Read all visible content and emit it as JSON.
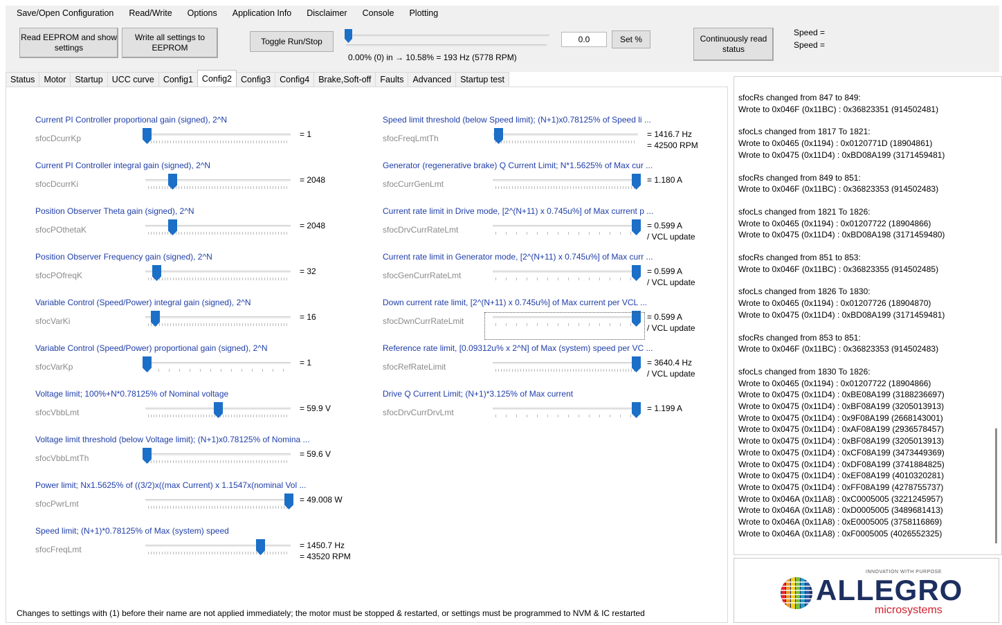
{
  "menu": [
    "Save/Open Configuration",
    "Read/Write",
    "Options",
    "Application Info",
    "Disclaimer",
    "Console",
    "Plotting"
  ],
  "toolbar": {
    "read_eeprom": "Read EEPROM and show settings",
    "write_all": "Write all settings to EEPROM",
    "toggle_run": "Toggle Run/Stop",
    "range_text": "0.00% (0) in → 10.58% = 193 Hz (5778 RPM)",
    "pct_value": "0.0",
    "set_pct": "Set %",
    "continuous": "Continuously read status",
    "speed1": "Speed =",
    "speed2": "Speed ="
  },
  "tabs": [
    "Status",
    "Motor",
    "Startup",
    "UCC curve",
    "Config1",
    "Config2",
    "Config3",
    "Config4",
    "Brake,Soft-off",
    "Faults",
    "Advanced",
    "Startup test"
  ],
  "active_tab": "Config2",
  "left_params": [
    {
      "title": "Current PI Controller proportional gain (signed), 2^N",
      "name": "sfocDcurrKp",
      "value": "= 1",
      "value2": "",
      "level": 0.0
    },
    {
      "title": "Current PI Controller integral gain (signed), 2^N",
      "name": "sfocDcurrKi",
      "value": "= 2048",
      "value2": "",
      "level": 0.18
    },
    {
      "title": "Position Observer Theta gain (signed), 2^N",
      "name": "sfocPOthetaK",
      "value": "= 2048",
      "value2": "",
      "level": 0.18
    },
    {
      "title": "Position Observer Frequency gain (signed), 2^N",
      "name": "sfocPOfreqK",
      "value": "= 32",
      "value2": "",
      "level": 0.07
    },
    {
      "title": "Variable Control (Speed/Power) integral gain (signed), 2^N",
      "name": "sfocVarKi",
      "value": "= 16",
      "value2": "",
      "level": 0.06
    },
    {
      "title": "Variable Control (Speed/Power) proportional gain (signed), 2^N",
      "name": "sfocVarKp",
      "value": "= 1",
      "value2": "",
      "level": 0.0
    },
    {
      "title": "Voltage limit; 100%+N*0.78125% of Nominal voltage",
      "name": "sfocVbbLmt",
      "value": "= 59.9 V",
      "value2": "",
      "level": 0.5
    },
    {
      "title": "Voltage limit threshold (below Voltage limit); (N+1)x0.78125% of Nomina ...",
      "name": "sfocVbbLmtTh",
      "value": "= 59.6 V",
      "value2": "",
      "level": 0.0
    },
    {
      "title": "Power limit; Nx1.5625% of ((3/2)x((max Current) x 1.1547x(nominal Vol ...",
      "name": "sfocPwrLmt",
      "value": "= 49.008 W",
      "value2": "",
      "level": 1.0
    },
    {
      "title": "Speed limit; (N+1)*0.78125% of Max (system) speed",
      "name": "sfocFreqLmt",
      "value": "= 1450.7 Hz",
      "value2": "= 43520 RPM",
      "level": 0.8
    }
  ],
  "right_params": [
    {
      "title": "Speed limit threshold (below Speed limit); (N+1)x0.78125% of Speed li ...",
      "name": "sfocFreqLmtTh",
      "value": "= 1416.7 Hz",
      "value2": "= 42500 RPM",
      "level": 0.03
    },
    {
      "title": "Generator (regenerative brake) Q Current Limit; N*1.5625% of Max cur ...",
      "name": "sfocCurrGenLmt",
      "value": "= 1.180 A",
      "value2": "",
      "level": 1.0
    },
    {
      "title": "Current rate limit in Drive mode, [2^(N+11) x 0.745u%] of Max current p ...",
      "name": "sfocDrvCurrRateLmt",
      "value": "= 0.599 A",
      "value2": "/ VCL update",
      "level": 1.0
    },
    {
      "title": "Current rate limit in Generator mode, [2^(N+11) x 0.745u%] of Max curr ...",
      "name": "sfocGenCurrRateLmt",
      "value": "= 0.599 A",
      "value2": "/ VCL update",
      "level": 1.0
    },
    {
      "title": "Down current rate limit, [2^(N+11) x 0.745u%] of Max current per VCL  ...",
      "name": "sfocDwnCurrRateLmit",
      "value": "= 0.599 A",
      "value2": "/ VCL update",
      "level": 1.0
    },
    {
      "title": "Reference rate limit, [0.09312u% x 2^N] of Max (system) speed per VC ...",
      "name": "sfocRefRateLimit",
      "value": "= 3640.4 Hz",
      "value2": "/ VCL update",
      "level": 1.0
    },
    {
      "title": "Drive Q Current Limit; (N+1)*3.125% of Max current",
      "name": "sfocDrvCurrDrvLmt",
      "value": "= 1.199 A",
      "value2": "",
      "level": 1.0
    }
  ],
  "footnote": "Changes to settings with (1) before their name are not applied immediately; the motor must be stopped & restarted, or settings must be programmed to NVM & IC restarted",
  "log": [
    [
      "sfocRs changed from 847 to 849:",
      "Wrote to 0x046F (0x11BC) : 0x36823351 (914502481)"
    ],
    [
      "sfocLs changed from 1817 To 1821:",
      "Wrote to 0x0465 (0x1194) : 0x0120771D (18904861)",
      "Wrote to 0x0475 (0x11D4) : 0xBD08A199 (3171459481)"
    ],
    [
      "sfocRs changed from 849 to 851:",
      "Wrote to 0x046F (0x11BC) : 0x36823353 (914502483)"
    ],
    [
      "sfocLs changed from 1821 To 1826:",
      "Wrote to 0x0465 (0x1194) : 0x01207722 (18904866)",
      "Wrote to 0x0475 (0x11D4) : 0xBD08A198 (3171459480)"
    ],
    [
      "sfocRs changed from 851 to 853:",
      "Wrote to 0x046F (0x11BC) : 0x36823355 (914502485)"
    ],
    [
      "sfocLs changed from 1826 To 1830:",
      "Wrote to 0x0465 (0x1194) : 0x01207726 (18904870)",
      "Wrote to 0x0475 (0x11D4) : 0xBD08A199 (3171459481)"
    ],
    [
      "sfocRs changed from 853 to 851:",
      "Wrote to 0x046F (0x11BC) : 0x36823353 (914502483)"
    ],
    [
      "sfocLs changed from 1830 To 1826:",
      "Wrote to 0x0465 (0x1194) : 0x01207722 (18904866)",
      "Wrote to 0x0475 (0x11D4) : 0xBE08A199 (3188236697)",
      "Wrote to 0x0475 (0x11D4) : 0xBF08A199 (3205013913)",
      "Wrote to 0x0475 (0x11D4) : 0x9F08A199 (2668143001)",
      "Wrote to 0x0475 (0x11D4) : 0xAF08A199 (2936578457)",
      "Wrote to 0x0475 (0x11D4) : 0xBF08A199 (3205013913)",
      "Wrote to 0x0475 (0x11D4) : 0xCF08A199 (3473449369)",
      "Wrote to 0x0475 (0x11D4) : 0xDF08A199 (3741884825)",
      "Wrote to 0x0475 (0x11D4) : 0xEF08A199 (4010320281)",
      "Wrote to 0x0475 (0x11D4) : 0xFF08A199 (4278755737)",
      "Wrote to 0x046A (0x11A8) : 0xC0005005 (3221245957)",
      "Wrote to 0x046A (0x11A8) : 0xD0005005 (3489681413)",
      "Wrote to 0x046A (0x11A8) : 0xE0005005 (3758116869)",
      "Wrote to 0x046A (0x11A8) : 0xF0005005 (4026552325)"
    ]
  ],
  "logo": {
    "tagline": "INNOVATION WITH PURPOSE",
    "word": "ALLEGRO",
    "sub": "microsystems"
  },
  "colors": {
    "accent": "#1b6fc7",
    "title_blue": "#1f3ea8",
    "logo_navy": "#1d2f5f",
    "logo_red": "#d0212f"
  }
}
